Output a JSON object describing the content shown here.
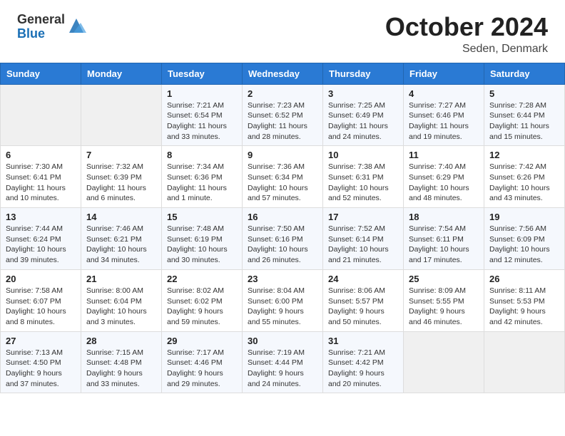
{
  "header": {
    "logo_general": "General",
    "logo_blue": "Blue",
    "month_title": "October 2024",
    "location": "Seden, Denmark"
  },
  "days_of_week": [
    "Sunday",
    "Monday",
    "Tuesday",
    "Wednesday",
    "Thursday",
    "Friday",
    "Saturday"
  ],
  "weeks": [
    [
      {
        "day": "",
        "sunrise": "",
        "sunset": "",
        "daylight": ""
      },
      {
        "day": "",
        "sunrise": "",
        "sunset": "",
        "daylight": ""
      },
      {
        "day": "1",
        "sunrise": "Sunrise: 7:21 AM",
        "sunset": "Sunset: 6:54 PM",
        "daylight": "Daylight: 11 hours and 33 minutes."
      },
      {
        "day": "2",
        "sunrise": "Sunrise: 7:23 AM",
        "sunset": "Sunset: 6:52 PM",
        "daylight": "Daylight: 11 hours and 28 minutes."
      },
      {
        "day": "3",
        "sunrise": "Sunrise: 7:25 AM",
        "sunset": "Sunset: 6:49 PM",
        "daylight": "Daylight: 11 hours and 24 minutes."
      },
      {
        "day": "4",
        "sunrise": "Sunrise: 7:27 AM",
        "sunset": "Sunset: 6:46 PM",
        "daylight": "Daylight: 11 hours and 19 minutes."
      },
      {
        "day": "5",
        "sunrise": "Sunrise: 7:28 AM",
        "sunset": "Sunset: 6:44 PM",
        "daylight": "Daylight: 11 hours and 15 minutes."
      }
    ],
    [
      {
        "day": "6",
        "sunrise": "Sunrise: 7:30 AM",
        "sunset": "Sunset: 6:41 PM",
        "daylight": "Daylight: 11 hours and 10 minutes."
      },
      {
        "day": "7",
        "sunrise": "Sunrise: 7:32 AM",
        "sunset": "Sunset: 6:39 PM",
        "daylight": "Daylight: 11 hours and 6 minutes."
      },
      {
        "day": "8",
        "sunrise": "Sunrise: 7:34 AM",
        "sunset": "Sunset: 6:36 PM",
        "daylight": "Daylight: 11 hours and 1 minute."
      },
      {
        "day": "9",
        "sunrise": "Sunrise: 7:36 AM",
        "sunset": "Sunset: 6:34 PM",
        "daylight": "Daylight: 10 hours and 57 minutes."
      },
      {
        "day": "10",
        "sunrise": "Sunrise: 7:38 AM",
        "sunset": "Sunset: 6:31 PM",
        "daylight": "Daylight: 10 hours and 52 minutes."
      },
      {
        "day": "11",
        "sunrise": "Sunrise: 7:40 AM",
        "sunset": "Sunset: 6:29 PM",
        "daylight": "Daylight: 10 hours and 48 minutes."
      },
      {
        "day": "12",
        "sunrise": "Sunrise: 7:42 AM",
        "sunset": "Sunset: 6:26 PM",
        "daylight": "Daylight: 10 hours and 43 minutes."
      }
    ],
    [
      {
        "day": "13",
        "sunrise": "Sunrise: 7:44 AM",
        "sunset": "Sunset: 6:24 PM",
        "daylight": "Daylight: 10 hours and 39 minutes."
      },
      {
        "day": "14",
        "sunrise": "Sunrise: 7:46 AM",
        "sunset": "Sunset: 6:21 PM",
        "daylight": "Daylight: 10 hours and 34 minutes."
      },
      {
        "day": "15",
        "sunrise": "Sunrise: 7:48 AM",
        "sunset": "Sunset: 6:19 PM",
        "daylight": "Daylight: 10 hours and 30 minutes."
      },
      {
        "day": "16",
        "sunrise": "Sunrise: 7:50 AM",
        "sunset": "Sunset: 6:16 PM",
        "daylight": "Daylight: 10 hours and 26 minutes."
      },
      {
        "day": "17",
        "sunrise": "Sunrise: 7:52 AM",
        "sunset": "Sunset: 6:14 PM",
        "daylight": "Daylight: 10 hours and 21 minutes."
      },
      {
        "day": "18",
        "sunrise": "Sunrise: 7:54 AM",
        "sunset": "Sunset: 6:11 PM",
        "daylight": "Daylight: 10 hours and 17 minutes."
      },
      {
        "day": "19",
        "sunrise": "Sunrise: 7:56 AM",
        "sunset": "Sunset: 6:09 PM",
        "daylight": "Daylight: 10 hours and 12 minutes."
      }
    ],
    [
      {
        "day": "20",
        "sunrise": "Sunrise: 7:58 AM",
        "sunset": "Sunset: 6:07 PM",
        "daylight": "Daylight: 10 hours and 8 minutes."
      },
      {
        "day": "21",
        "sunrise": "Sunrise: 8:00 AM",
        "sunset": "Sunset: 6:04 PM",
        "daylight": "Daylight: 10 hours and 3 minutes."
      },
      {
        "day": "22",
        "sunrise": "Sunrise: 8:02 AM",
        "sunset": "Sunset: 6:02 PM",
        "daylight": "Daylight: 9 hours and 59 minutes."
      },
      {
        "day": "23",
        "sunrise": "Sunrise: 8:04 AM",
        "sunset": "Sunset: 6:00 PM",
        "daylight": "Daylight: 9 hours and 55 minutes."
      },
      {
        "day": "24",
        "sunrise": "Sunrise: 8:06 AM",
        "sunset": "Sunset: 5:57 PM",
        "daylight": "Daylight: 9 hours and 50 minutes."
      },
      {
        "day": "25",
        "sunrise": "Sunrise: 8:09 AM",
        "sunset": "Sunset: 5:55 PM",
        "daylight": "Daylight: 9 hours and 46 minutes."
      },
      {
        "day": "26",
        "sunrise": "Sunrise: 8:11 AM",
        "sunset": "Sunset: 5:53 PM",
        "daylight": "Daylight: 9 hours and 42 minutes."
      }
    ],
    [
      {
        "day": "27",
        "sunrise": "Sunrise: 7:13 AM",
        "sunset": "Sunset: 4:50 PM",
        "daylight": "Daylight: 9 hours and 37 minutes."
      },
      {
        "day": "28",
        "sunrise": "Sunrise: 7:15 AM",
        "sunset": "Sunset: 4:48 PM",
        "daylight": "Daylight: 9 hours and 33 minutes."
      },
      {
        "day": "29",
        "sunrise": "Sunrise: 7:17 AM",
        "sunset": "Sunset: 4:46 PM",
        "daylight": "Daylight: 9 hours and 29 minutes."
      },
      {
        "day": "30",
        "sunrise": "Sunrise: 7:19 AM",
        "sunset": "Sunset: 4:44 PM",
        "daylight": "Daylight: 9 hours and 24 minutes."
      },
      {
        "day": "31",
        "sunrise": "Sunrise: 7:21 AM",
        "sunset": "Sunset: 4:42 PM",
        "daylight": "Daylight: 9 hours and 20 minutes."
      },
      {
        "day": "",
        "sunrise": "",
        "sunset": "",
        "daylight": ""
      },
      {
        "day": "",
        "sunrise": "",
        "sunset": "",
        "daylight": ""
      }
    ]
  ]
}
